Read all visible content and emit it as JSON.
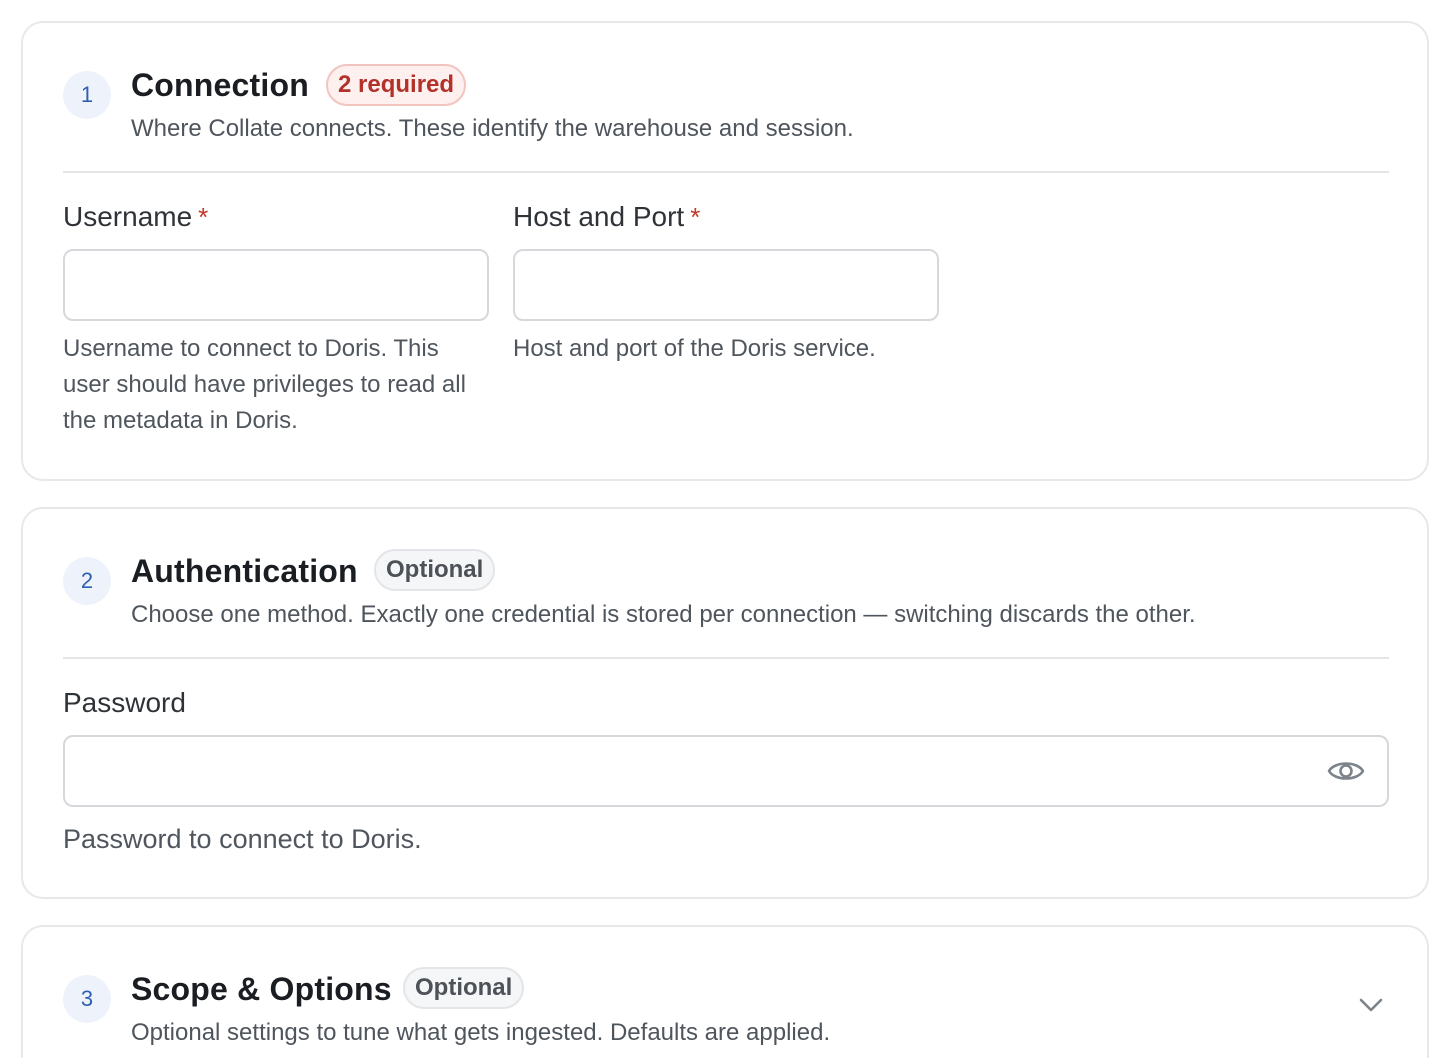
{
  "sections": [
    {
      "number": "1",
      "title": "Connection",
      "badge": "2 required",
      "subtitle": "Where Collate connects. These identify the warehouse and session.",
      "fields": [
        {
          "label": "Username",
          "required_mark": "*",
          "value": "",
          "helper": "Username to connect to Doris. This user should have privileges to read all the metadata in Doris."
        },
        {
          "label": "Host and Port",
          "required_mark": "*",
          "value": "",
          "helper": "Host and port of the Doris service."
        }
      ]
    },
    {
      "number": "2",
      "title": "Authentication",
      "badge": "Optional",
      "subtitle": "Choose one method. Exactly one credential is stored per connection — switching discards the other.",
      "fields": [
        {
          "label": "Password",
          "value": "",
          "helper": "Password to connect to Doris.",
          "icon": "eye-icon"
        }
      ]
    },
    {
      "number": "3",
      "title": "Scope & Options",
      "badge": "Optional",
      "subtitle": "Optional settings to tune what gets ingested. Defaults are applied.",
      "collapsed_icon": "chevron-down-icon"
    }
  ],
  "colors": {
    "accent": "#2f5fb3",
    "required": "#c0392b",
    "border": "#e7e8ea"
  }
}
